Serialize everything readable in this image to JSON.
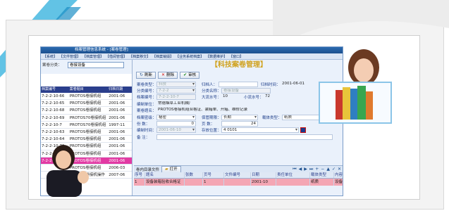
{
  "window": {
    "title": "档案管理信息系统 - [案卷管理]",
    "menu": [
      "【系统】",
      "【文件管理】",
      "【档案管理】",
      "【借阅管理】",
      "【档案移交】",
      "【档案销毁】",
      "【业务系统档案】",
      "【数据维护】",
      "【窗口】"
    ]
  },
  "left_panel": {
    "category_label": "案卷分类：",
    "category_value": "卷接设备",
    "columns": [
      "档案编号",
      "案卷题目",
      "归档日期"
    ],
    "rows": [
      [
        "7-2-2-10-66",
        "PROTOS卷接机组",
        "2001-06"
      ],
      [
        "7-2-2-10-65",
        "PROTOS卷接机组",
        "2001-06"
      ],
      [
        "7-2-2-10-68",
        "PROTOS卷接机组",
        "2001-06"
      ],
      [
        "7-2-2-10-69",
        "PROTOS70卷接机组",
        "2001-06"
      ],
      [
        "7-2-2-10-7",
        "PROTOS70卷接机组",
        "1997-11"
      ],
      [
        "7-2-2-10-63",
        "PROTOS卷接机组",
        "2001-06"
      ],
      [
        "7-2-2-10-64",
        "PROTOS卷接机组",
        "2001-06"
      ],
      [
        "7-2-2-10-70",
        "PROTOS卷接机组",
        "2001-06"
      ],
      [
        "7-2-2-10-62",
        "PROTOS卷接机组",
        "2001-06"
      ],
      [
        "7-2-2-10-67",
        "PROTOS卷接机组",
        "2001-06"
      ],
      [
        "",
        "PROTOS卷接机组",
        "2006-03"
      ],
      [
        "",
        "PROTOS卷接机操作",
        "2007-06"
      ]
    ],
    "selected_index": 9
  },
  "main": {
    "heading": "【科技案卷管理】",
    "toolbar": {
      "refresh": "刷新",
      "delete": "删除",
      "audit": "审核"
    },
    "form": {
      "type_label": "案卷类型：",
      "type_value": "科技",
      "filer_label": "归档人：",
      "filer_value": "",
      "file_date_label": "归档时间：",
      "file_date_value": "2001-06-01",
      "class_no_label": "分类编号：",
      "class_no_value": "7-2-2",
      "class_name_label": "分类名称：",
      "class_name_value": "卷接设备",
      "archive_no_label": "档案编号：",
      "archive_no_value": "7-2-2-10-7",
      "big_flow_label": "大流水号：",
      "big_flow_value": "10",
      "small_flow_label": "小流水号：",
      "small_flow_value": "72",
      "unit_label": "编制单位：",
      "unit_value": "常德烟草工业机械厂",
      "title_label": "案卷题名：",
      "title_value": "PROTOS卷接机组合格证、装箱单、开箱、维修记录",
      "secret_label": "档案密级：",
      "secret_value": "秘密",
      "keep_label": "保管期限：",
      "keep_value": "长期",
      "carrier_label": "载体类型：",
      "carrier_value": "纸质",
      "count_label": "份   数：",
      "count_value": "0",
      "pages_label": "页   数：",
      "pages_value": "24",
      "edit_date_label": "编制时间：",
      "edit_date_value": "2001-06-10",
      "location_label": "存放位置：",
      "location_value": "4  0101",
      "note_label": "备   注："
    },
    "sub": {
      "label": "卷内目录文件",
      "open_label": "打开",
      "nav": [
        "⏮",
        "◀",
        "▶",
        "⏭",
        "+",
        "−",
        "▲",
        "✓",
        "✕"
      ],
      "columns": [
        "序号",
        "题名",
        "张数",
        "页号",
        "文件编号",
        "日期",
        "责任单位",
        "载体类型",
        "内容描述"
      ],
      "rows": [
        [
          "1",
          "设备装箱验收合格证",
          "",
          "1",
          "",
          "2001-10",
          "",
          "纸质",
          "设备装箱验收合格证明书"
        ]
      ]
    }
  },
  "colors": {
    "accent": "#2a3e8c",
    "selection": "#e23aa3",
    "heading": "#d0a21e",
    "row_highlight": "#f4a6b4"
  }
}
